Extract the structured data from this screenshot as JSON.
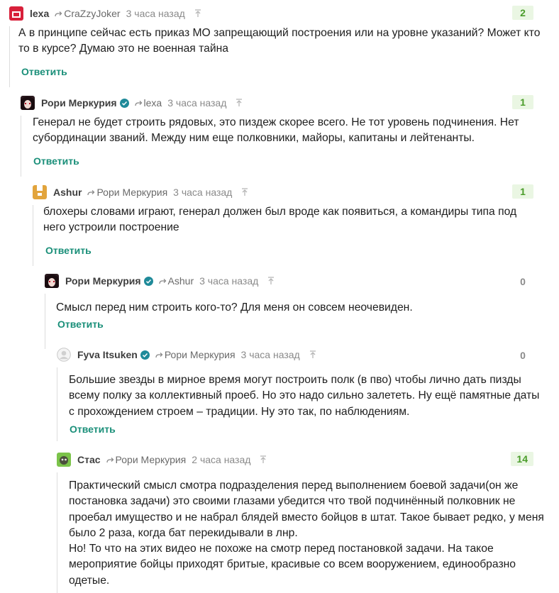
{
  "colors": {
    "accent": "#1a8f79",
    "score_positive_bg": "#eaf6e3",
    "score_positive_text": "#4a9c2a",
    "muted": "#8a8a8a"
  },
  "comments": [
    {
      "author": "lexa",
      "avatar": "red-square-avatar",
      "verified": false,
      "reply_to": "CraZzyJoker",
      "time": "3 часа назад",
      "score": "2",
      "score_kind": "positive",
      "text": "А в принципе сейчас есть приказ МО запрещающий построения или на уровне указаний? Может кто то в курсе? Думаю это не военная тайна",
      "answer": "Ответить"
    },
    {
      "author": "Рори Меркурия",
      "avatar": "anime-avatar",
      "verified": true,
      "reply_to": "lexa",
      "time": "3 часа назад",
      "score": "1",
      "score_kind": "positive",
      "text": "Генерал не будет строить рядовых, это пиздеж скорее всего. Не тот уровень подчинения. Нет субординации званий. Между ним еще полковники, майоры, капитаны и лейтенанты.",
      "answer": "Ответить"
    },
    {
      "author": "Ashur",
      "avatar": "orange-pixel-avatar",
      "verified": false,
      "reply_to": "Рори Меркурия",
      "time": "3 часа назад",
      "score": "1",
      "score_kind": "positive",
      "text": "блохеры словами играют, генерал должен был вроде как появиться, а командиры типа под него устроили построение",
      "answer": "Ответить"
    },
    {
      "author": "Рори Меркурия",
      "avatar": "anime-avatar",
      "verified": true,
      "reply_to": "Ashur",
      "time": "3 часа назад",
      "score": "0",
      "score_kind": "zero",
      "text": "Смысл перед ним строить кого-то? Для меня он совсем неочевиден.",
      "answer": "Ответить"
    },
    {
      "author": "Fyva Itsuken",
      "avatar": "default-user-avatar",
      "verified": true,
      "reply_to": "Рори Меркурия",
      "time": "3 часа назад",
      "score": "0",
      "score_kind": "zero",
      "text": "Большие звезды в мирное время могут построить полк (в пво) чтобы лично дать пизды всему полку за коллективный проеб. Но это надо сильно залететь. Ну ещё памятные даты с прохождением строем – традиции. Ну это так, по наблюдениям.",
      "answer": "Ответить"
    },
    {
      "author": "Стас",
      "avatar": "green-avatar",
      "verified": false,
      "reply_to": "Рори Меркурия",
      "time": "2 часа назад",
      "score": "14",
      "score_kind": "positive",
      "text": "Практический смысл смотра подразделения перед выполнением боевой задачи(он же постановка задачи) это своими глазами убедится что твой подчинённый полковник не проебал имущество и не набрал блядей вместо бойцов в штат. Такое бывает редко, у меня было 2 раза, когда бат перекидывали в лнр.",
      "text2": "Но! То что на этих видео не похоже на смотр перед постановкой задачи. На такое мероприятие бойцы приходят бритые, красивые со всем вооружением, единообразно одетые."
    }
  ]
}
